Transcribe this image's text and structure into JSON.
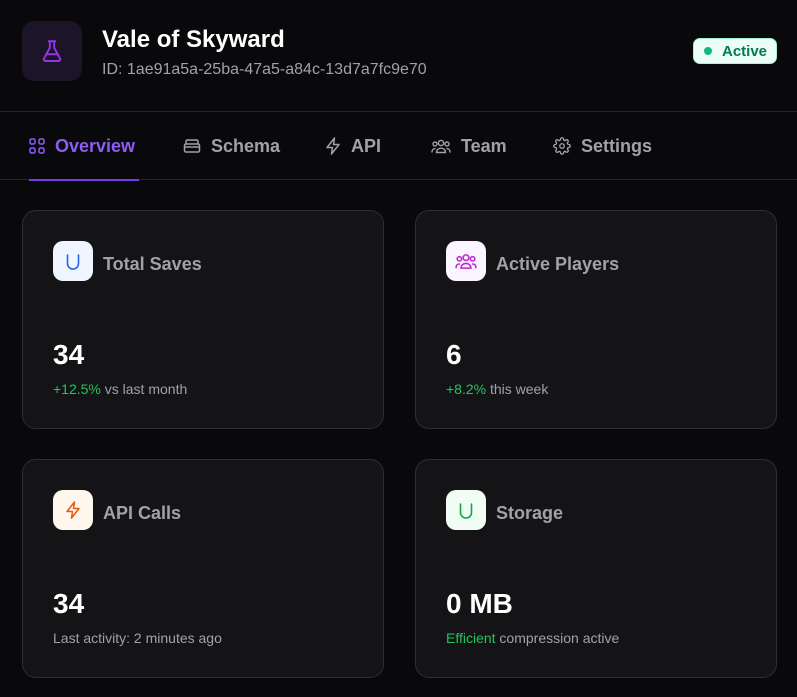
{
  "app": {
    "title": "Vale of Skyward",
    "id_text": "ID: 1ae91a5a-25ba-47a5-a84c-13d7a7fc9e70",
    "icon": "flask-icon",
    "status": "Active"
  },
  "tabs": [
    {
      "label": "Overview",
      "icon": "grid-icon",
      "active": true
    },
    {
      "label": "Schema",
      "icon": "database-icon",
      "active": false
    },
    {
      "label": "API",
      "icon": "lightning-icon",
      "active": false
    },
    {
      "label": "Team",
      "icon": "users-icon",
      "active": false
    },
    {
      "label": "Settings",
      "icon": "gear-icon",
      "active": false
    }
  ],
  "cards": [
    {
      "label": "Total Saves",
      "icon": "save-icon",
      "value": "34",
      "highlight": "+12.5%",
      "sub": " vs last month"
    },
    {
      "label": "Active Players",
      "icon": "users-icon",
      "value": "6",
      "highlight": "+8.2%",
      "sub": " this week"
    },
    {
      "label": "API Calls",
      "icon": "lightning-icon",
      "value": "34",
      "highlight": "",
      "sub": "Last activity: 2 minutes ago"
    },
    {
      "label": "Storage",
      "icon": "storage-icon",
      "value": "0 MB",
      "highlight": "Efficient",
      "sub": " compression active"
    }
  ],
  "colors": {
    "accent": "#7c3aed",
    "accent_text": "#8b5cf6",
    "positive": "#22c55e",
    "status_bg": "#ecfdf5",
    "status_text": "#047857",
    "background": "#09090b",
    "card_bg": "#141416"
  }
}
